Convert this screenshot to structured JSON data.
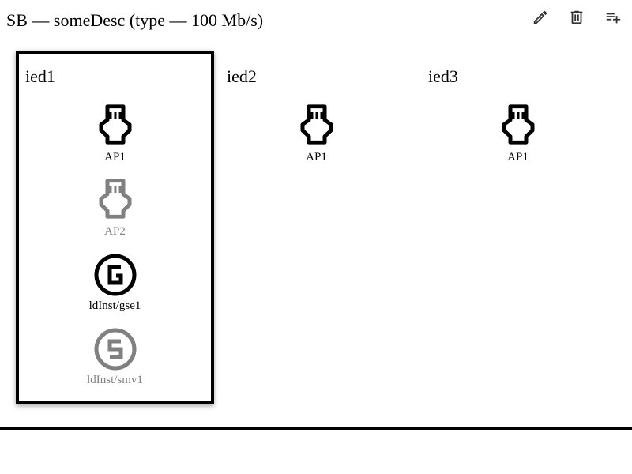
{
  "header": {
    "title": "SB — someDesc (type — 100 Mb/s)",
    "actions": [
      {
        "name": "edit-button",
        "icon": "pencil-icon"
      },
      {
        "name": "delete-button",
        "icon": "trash-icon"
      },
      {
        "name": "add-to-list-button",
        "icon": "playlist-add-icon"
      }
    ]
  },
  "ieds": [
    {
      "name": "ied1",
      "selected": true,
      "items": [
        {
          "label": "AP1",
          "icon": "ethernet-port-icon",
          "dim": false
        },
        {
          "label": "AP2",
          "icon": "ethernet-port-icon",
          "dim": true
        },
        {
          "label": "ldInst/gse1",
          "icon": "goose-icon",
          "dim": false
        },
        {
          "label": "ldInst/smv1",
          "icon": "smv-icon",
          "dim": true
        }
      ]
    },
    {
      "name": "ied2",
      "selected": false,
      "items": [
        {
          "label": "AP1",
          "icon": "ethernet-port-icon",
          "dim": false
        }
      ]
    },
    {
      "name": "ied3",
      "selected": false,
      "items": [
        {
          "label": "AP1",
          "icon": "ethernet-port-icon",
          "dim": false
        }
      ]
    }
  ]
}
